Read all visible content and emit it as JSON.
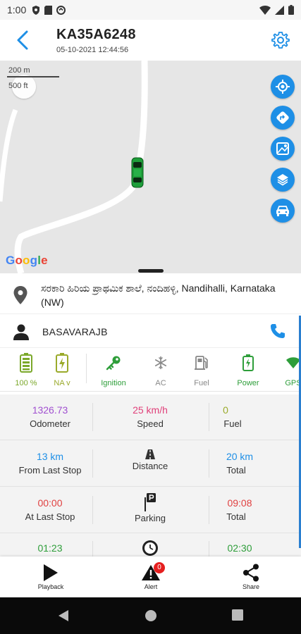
{
  "status_bar": {
    "time": "1:00"
  },
  "header": {
    "title": "KA35A6248",
    "datetime": "05-10-2021 12:44:56"
  },
  "map": {
    "scale_metric": "200 m",
    "scale_imperial": "500 ft",
    "attribution": "Google",
    "actions": [
      "locate-icon",
      "directions-icon",
      "map-view-icon",
      "layers-icon",
      "vehicle-icon"
    ]
  },
  "address": {
    "text": "ಸರಕಾರಿ ಹಿರಿಯ ಪ್ರಾಥಮಿಕ ಶಾಲೆ, ನಂದಿಹಳ್ಳಿ, Nandihalli, Karnataka (NW)"
  },
  "driver": {
    "name": "BASAVARAJB"
  },
  "status_strip": {
    "battery_value": "100  %",
    "external_value": "NA v",
    "ignition": "Ignition",
    "ac": "AC",
    "fuel": "Fuel",
    "power": "Power",
    "gps": "GPS"
  },
  "stats": {
    "odometer_value": "1326.73",
    "odometer_label": "Odometer",
    "speed_value": "25 km/h",
    "speed_label": "Speed",
    "fuel_value": "0",
    "fuel_label": "Fuel",
    "from_last_stop_value": "13 km",
    "from_last_stop_label": "From Last Stop",
    "distance_label": "Distance",
    "total_distance_value": "20 km",
    "total_distance_label": "Total",
    "at_last_stop_value": "00:00",
    "at_last_stop_label": "At Last Stop",
    "parking_label": "Parking",
    "total_parking_value": "09:08",
    "total_parking_label": "Total",
    "running_value": "01:23",
    "total_running_value": "02:30"
  },
  "bottom_nav": {
    "playback": "Playback",
    "alert": "Alert",
    "alert_count": "0",
    "share": "Share"
  },
  "colors": {
    "accent": "#1e8fe6",
    "green": "#2e9e3a",
    "purple": "#a04fd0",
    "pink": "#e0407a",
    "red": "#e04040",
    "olive": "#9aaa2a"
  }
}
